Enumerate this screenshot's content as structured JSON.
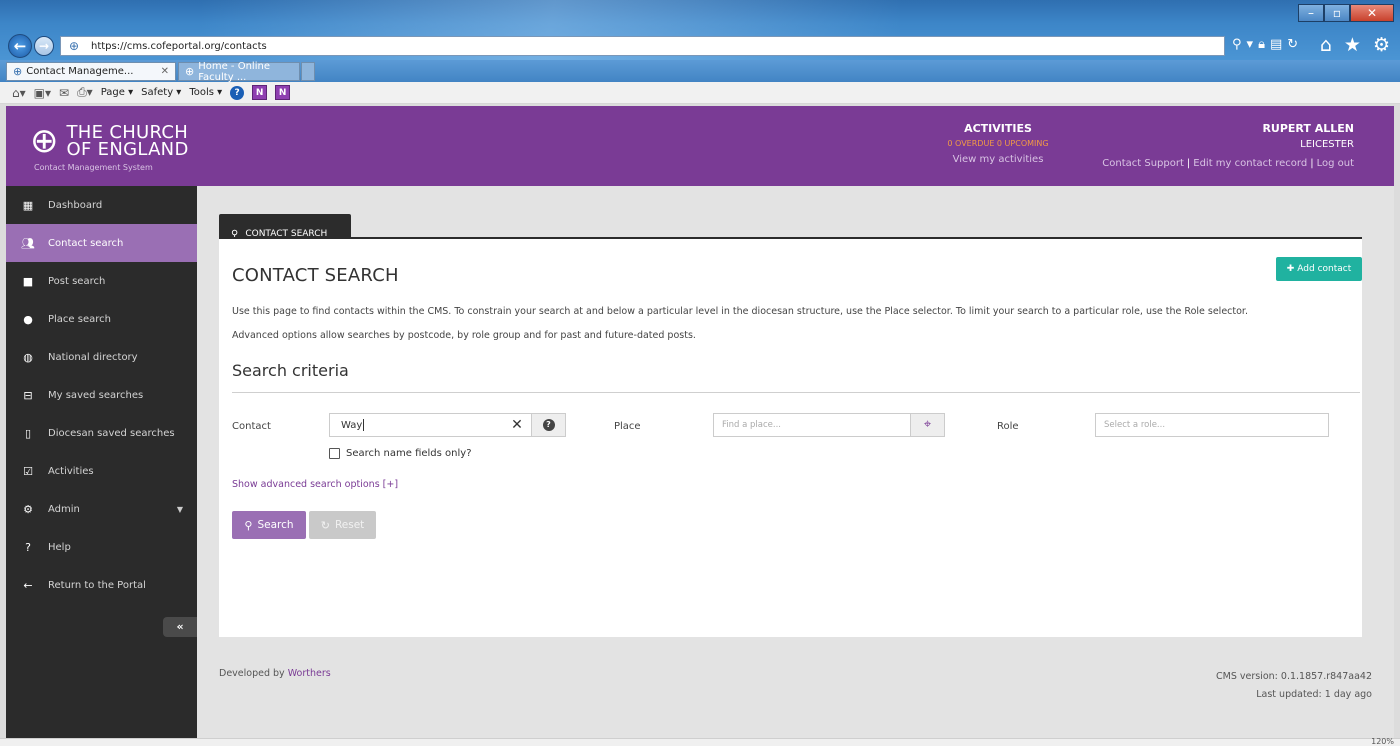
{
  "browser": {
    "url": "https://cms.cofeportal.org/contacts",
    "tabs": [
      {
        "label": "Contact Manageme...",
        "active": true
      },
      {
        "label": "Home - Online Faculty ...",
        "active": false
      }
    ],
    "menu": {
      "page": "Page",
      "safety": "Safety",
      "tools": "Tools"
    },
    "zoom": "120%"
  },
  "header": {
    "logo_line1": "THE CHURCH",
    "logo_line2": "OF ENGLAND",
    "logo_sub": "Contact Management System",
    "activities_title": "ACTIVITIES",
    "overdue": "0 OVERDUE",
    "upcoming": "0 UPCOMING",
    "view_activities": "View my activities",
    "user_name": "RUPERT ALLEN",
    "user_diocese": "LEICESTER",
    "link_support": "Contact Support",
    "link_edit": "Edit my contact record",
    "link_logout": "Log out"
  },
  "sidebar": {
    "items": [
      {
        "label": "Dashboard",
        "icon": "grid-icon"
      },
      {
        "label": "Contact search",
        "icon": "users-icon"
      },
      {
        "label": "Post search",
        "icon": "briefcase-icon"
      },
      {
        "label": "Place search",
        "icon": "map-marker-icon"
      },
      {
        "label": "National directory",
        "icon": "globe-icon"
      },
      {
        "label": "My saved searches",
        "icon": "inbox-icon"
      },
      {
        "label": "Diocesan saved searches",
        "icon": "book-icon"
      },
      {
        "label": "Activities",
        "icon": "check-square-icon"
      },
      {
        "label": "Admin",
        "icon": "cogs-icon"
      },
      {
        "label": "Help",
        "icon": "question-icon"
      },
      {
        "label": "Return to the Portal",
        "icon": "arrow-left-icon"
      }
    ],
    "active_index": 1,
    "collapse": "«"
  },
  "main": {
    "tab_label": "CONTACT SEARCH",
    "title": "CONTACT SEARCH",
    "add_contact": "Add contact",
    "desc1": "Use this page to find contacts within the CMS. To constrain your search at and below a particular level in the diocesan structure, use the Place selector. To limit your search to a particular role, use the Role selector.",
    "desc2": "Advanced options allow searches by postcode, by role group and for past and future-dated posts.",
    "criteria_title": "Search criteria",
    "contact_label": "Contact",
    "contact_value": "Way",
    "place_label": "Place",
    "place_placeholder": "Find a place...",
    "role_label": "Role",
    "role_placeholder": "Select a role...",
    "checkbox_label": "Search name fields only?",
    "advanced_link": "Show advanced search options [+]",
    "search_btn": "Search",
    "reset_btn": "Reset"
  },
  "footer": {
    "developed_by": "Developed by",
    "developer": "Worthers",
    "version": "CMS version: 0.1.1857.r847aa42",
    "updated": "Last updated: 1 day ago"
  },
  "colors": {
    "brand_purple": "#7a3b95",
    "active_purple": "#9a6fb4",
    "teal": "#20b2a0",
    "sidebar_bg": "#2b2b2b"
  }
}
